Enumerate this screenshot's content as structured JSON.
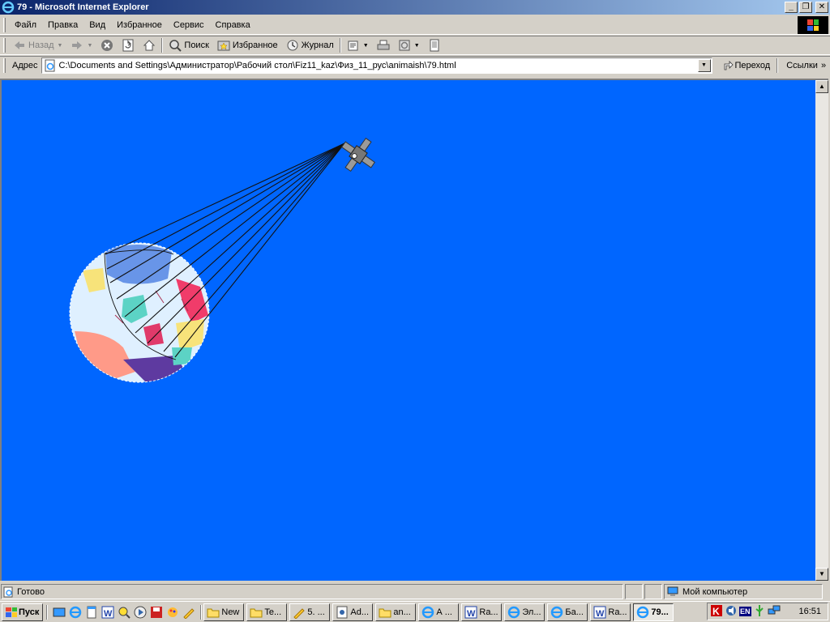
{
  "window": {
    "title": "79 - Microsoft Internet Explorer",
    "min": "_",
    "max": "❐",
    "close": "✕"
  },
  "menu": [
    "Файл",
    "Правка",
    "Вид",
    "Избранное",
    "Сервис",
    "Справка"
  ],
  "toolbar": {
    "back": "Назад",
    "search": "Поиск",
    "favorites": "Избранное",
    "history": "Журнал"
  },
  "address": {
    "label": "Адрес",
    "value": "C:\\Documents and Settings\\Администратор\\Рабочий стол\\Fiz11_kaz\\Физ_11_рус\\animaish\\79.html",
    "go": "Переход",
    "links": "Ссылки"
  },
  "status": {
    "text": "Готово",
    "zone": "Мой компьютер"
  },
  "taskbar": {
    "start": "Пуск",
    "tasks": [
      "New",
      "Te...",
      "5. ...",
      "Ad...",
      "an...",
      "А ...",
      "Ra...",
      "Эл...",
      "Ба...",
      "Ra...",
      "79..."
    ],
    "lang": "EN",
    "clock": "16:51"
  },
  "colors": {
    "page_bg": "#0066ff",
    "title_gradient_start": "#0a246a"
  }
}
